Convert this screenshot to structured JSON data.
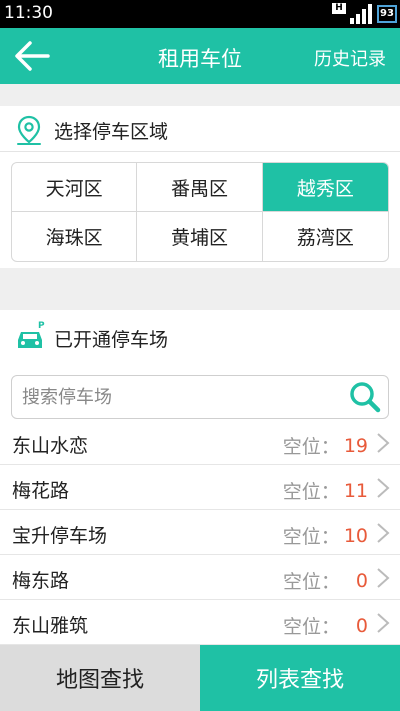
{
  "status": {
    "time": "11:30",
    "network": "H",
    "battery": "93"
  },
  "header": {
    "title": "租用车位",
    "history_label": "历史记录"
  },
  "district_section": {
    "title": "选择停车区域",
    "districts": [
      {
        "label": "天河区",
        "selected": false
      },
      {
        "label": "番禺区",
        "selected": false
      },
      {
        "label": "越秀区",
        "selected": true
      },
      {
        "label": "海珠区",
        "selected": false
      },
      {
        "label": "黄埔区",
        "selected": false
      },
      {
        "label": "荔湾区",
        "selected": false
      }
    ]
  },
  "lots_section": {
    "title": "已开通停车场",
    "search_placeholder": "搜索停车场",
    "lots": [
      {
        "name": "东山水恋",
        "label": "空位：",
        "count": "19"
      },
      {
        "name": "梅花路",
        "label": "空位：",
        "count": "11"
      },
      {
        "name": "宝升停车场",
        "label": "空位：",
        "count": "10"
      },
      {
        "name": "梅东路",
        "label": "空位：",
        "count": "0"
      },
      {
        "name": "东山雅筑",
        "label": "空位：",
        "count": "0"
      }
    ]
  },
  "bottom_tabs": {
    "map": "地图查找",
    "list": "列表查找"
  },
  "colors": {
    "accent": "#1fc1a5",
    "count": "#e85a3a"
  }
}
